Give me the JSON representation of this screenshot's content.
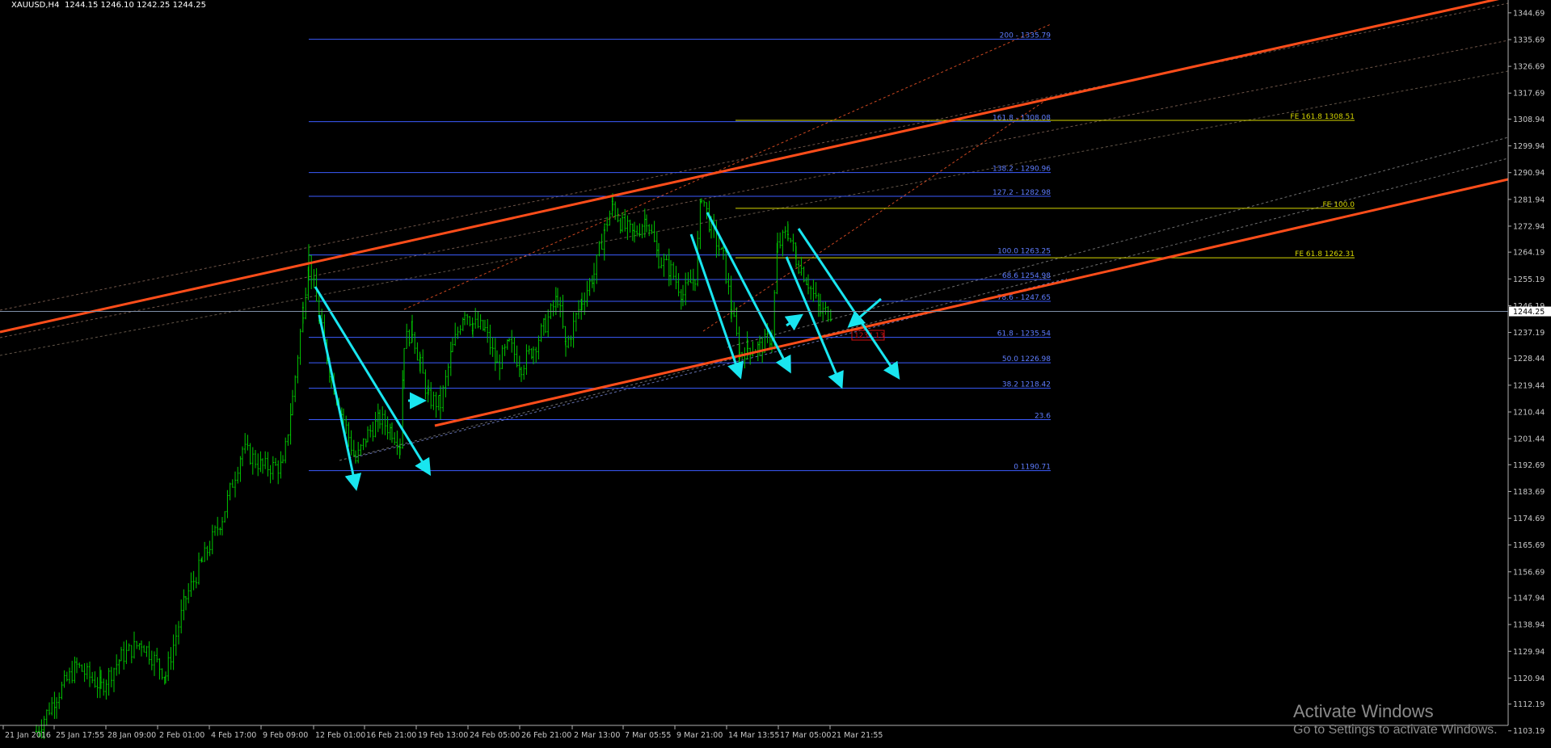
{
  "header": {
    "symbol": "XAUUSD,H4",
    "ohlc": "1244.15 1246.10 1242.25 1244.25"
  },
  "watermark": {
    "title": "Activate Windows",
    "subtitle": "Go to Settings to activate Windows."
  },
  "colors": {
    "background": "#000000",
    "candle": "#00c800",
    "fib_levels": "#3b5cff",
    "fib_text": "#5f7dff",
    "fe_levels": "#d6d600",
    "channel": "#ff4d1a",
    "arrows": "#19e6f0",
    "axis_text": "#c8c8c8",
    "current_price_bg": "#ffffff"
  },
  "chart_data": {
    "type": "candlestick",
    "title": "",
    "current_price": "1244.25",
    "ylim": [
      1098.5,
      1349.0
    ],
    "y_ticks": [
      "1344.69",
      "1335.69",
      "1326.69",
      "1317.69",
      "1308.94",
      "1299.94",
      "1290.94",
      "1281.94",
      "1272.94",
      "1264.19",
      "1255.19",
      "1246.19",
      "1237.19",
      "1228.44",
      "1219.44",
      "1210.44",
      "1201.44",
      "1192.69",
      "1183.69",
      "1174.69",
      "1165.69",
      "1156.69",
      "1147.94",
      "1138.94",
      "1129.94",
      "1120.94",
      "1112.19",
      "1103.19"
    ],
    "x_ticks": [
      "21 Jan 2016",
      "25 Jan 17:55",
      "28 Jan 09:00",
      "2 Feb 01:00",
      "4 Feb 17:00",
      "9 Feb 09:00",
      "12 Feb 01:00",
      "16 Feb 21:00",
      "19 Feb 13:00",
      "24 Feb 05:00",
      "26 Feb 21:00",
      "2 Mar 13:00",
      "7 Mar 05:55",
      "9 Mar 21:00",
      "14 Mar 13:55",
      "17 Mar 05:00",
      "21 Mar 21:55"
    ],
    "fib_retracement": [
      {
        "level": "200",
        "value": "1335.79",
        "label": "200 - 1335.79"
      },
      {
        "level": "161.8",
        "value": "1308.08",
        "label": "161.8 - 1308.08"
      },
      {
        "level": "138.2",
        "value": "1290.96",
        "label": "138.2 - 1290.96"
      },
      {
        "level": "127.2",
        "value": "1282.98",
        "label": "127.2 - 1282.98"
      },
      {
        "level": "100.0",
        "value": "1263.25",
        "label": "100.0 1263.25"
      },
      {
        "level": "68.6",
        "value": "1254.98",
        "label": "68.6 1254.98"
      },
      {
        "level": "78.6",
        "value": "1247.65",
        "label": "78.6 - 1247.65"
      },
      {
        "level": "61.8",
        "value": "1235.54",
        "label": "61.8 - 1235.54"
      },
      {
        "level": "50.0",
        "value": "1226.98",
        "label": "50.0 1226.98"
      },
      {
        "level": "38.2",
        "value": "1218.42",
        "label": "38.2 1218.42"
      },
      {
        "level": "23.6",
        "value": "1207.84",
        "label": "23.6"
      },
      {
        "level": "0",
        "value": "1190.71",
        "label": "0 1190.71"
      }
    ],
    "fib_expansion": [
      {
        "value": "1308.51",
        "label": "FE 161.8 1308.51"
      },
      {
        "value": "1278.95",
        "label": "FE 100.0"
      },
      {
        "value": "1262.31",
        "label": "FE 61.8 1262.31"
      }
    ],
    "callout_label": "1234.13",
    "candles": []
  }
}
